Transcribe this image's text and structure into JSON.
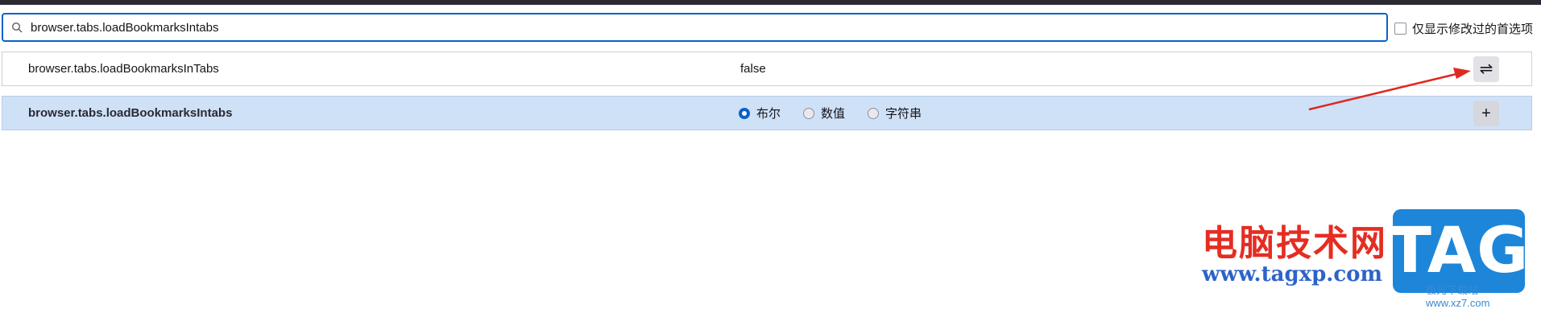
{
  "search": {
    "value": "browser.tabs.loadBookmarksIntabs",
    "icon": "search-icon"
  },
  "filter": {
    "label": "仅显示修改过的首选项",
    "checked": false
  },
  "existing_pref": {
    "name": "browser.tabs.loadBookmarksInTabs",
    "value": "false",
    "toggle_icon": "toggle-arrows-icon",
    "toggle_glyph": "⇌"
  },
  "new_pref": {
    "name": "browser.tabs.loadBookmarksIntabs",
    "types": [
      {
        "label": "布尔",
        "selected": true
      },
      {
        "label": "数值",
        "selected": false
      },
      {
        "label": "字符串",
        "selected": false
      }
    ],
    "add_icon": "plus-icon",
    "add_glyph": "+"
  },
  "colors": {
    "accent": "#0a61c9",
    "highlight_row": "#cfe1f7",
    "annotation_arrow": "#e0281f"
  },
  "watermark": {
    "cn": "电脑技术网",
    "url": "www.tagxp.com",
    "logo": "TAG",
    "sub": "极光下载站 www.xz7.com"
  }
}
